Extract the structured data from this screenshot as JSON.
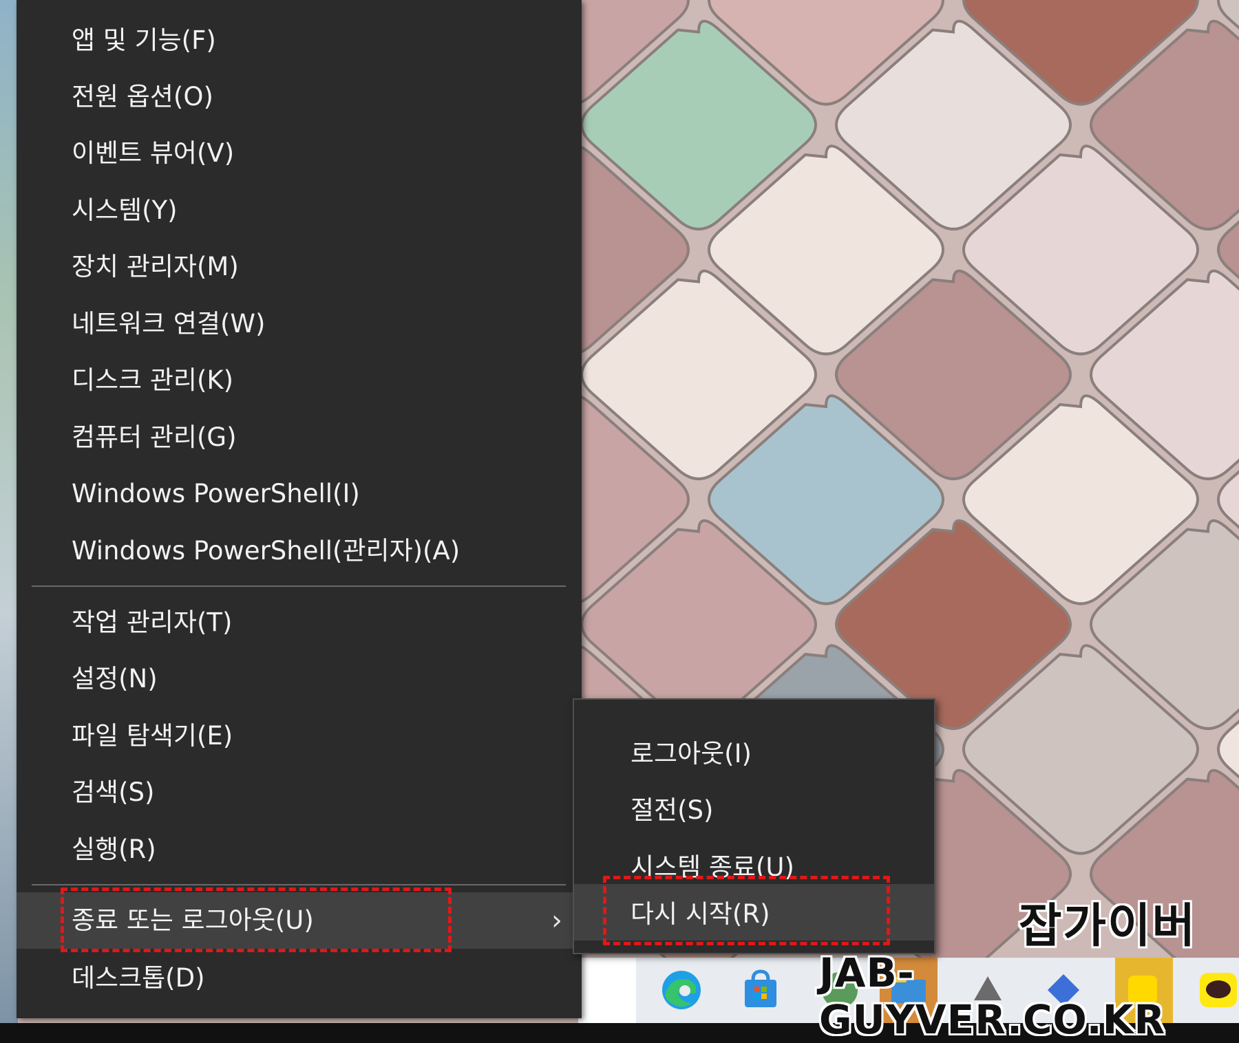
{
  "context_menu": {
    "items_group1": [
      {
        "label": "앱 및 기능(F)"
      },
      {
        "label": "전원 옵션(O)"
      },
      {
        "label": "이벤트 뷰어(V)"
      },
      {
        "label": "시스템(Y)"
      },
      {
        "label": "장치 관리자(M)"
      },
      {
        "label": "네트워크 연결(W)"
      },
      {
        "label": "디스크 관리(K)"
      },
      {
        "label": "컴퓨터 관리(G)"
      },
      {
        "label": "Windows PowerShell(I)"
      },
      {
        "label": "Windows PowerShell(관리자)(A)"
      }
    ],
    "items_group2": [
      {
        "label": "작업 관리자(T)"
      },
      {
        "label": "설정(N)"
      },
      {
        "label": "파일 탐색기(E)"
      },
      {
        "label": "검색(S)"
      },
      {
        "label": "실행(R)"
      }
    ],
    "shutdown": {
      "label": "종료 또는 로그아웃(U)",
      "chevron": "›"
    },
    "desktop": {
      "label": "데스크톱(D)"
    }
  },
  "submenu": {
    "items": [
      {
        "label": "로그아웃(I)"
      },
      {
        "label": "절전(S)"
      },
      {
        "label": "시스템 종료(U)"
      },
      {
        "label": "다시 시작(R)"
      }
    ]
  },
  "taskbar": {
    "icons": [
      "edge-icon",
      "store-icon",
      "app-icon",
      "folder-icon",
      "app-icon",
      "app-icon",
      "app-icon",
      "kakaotalk-icon"
    ]
  },
  "watermark": {
    "korean": "잡가이버",
    "site": "JAB-GUYVER.CO.KR"
  },
  "colors": {
    "menu_bg": "#2b2b2b",
    "menu_highlight": "#414141",
    "menu_text": "#f2f2f2",
    "annotation_red": "#e01818"
  }
}
